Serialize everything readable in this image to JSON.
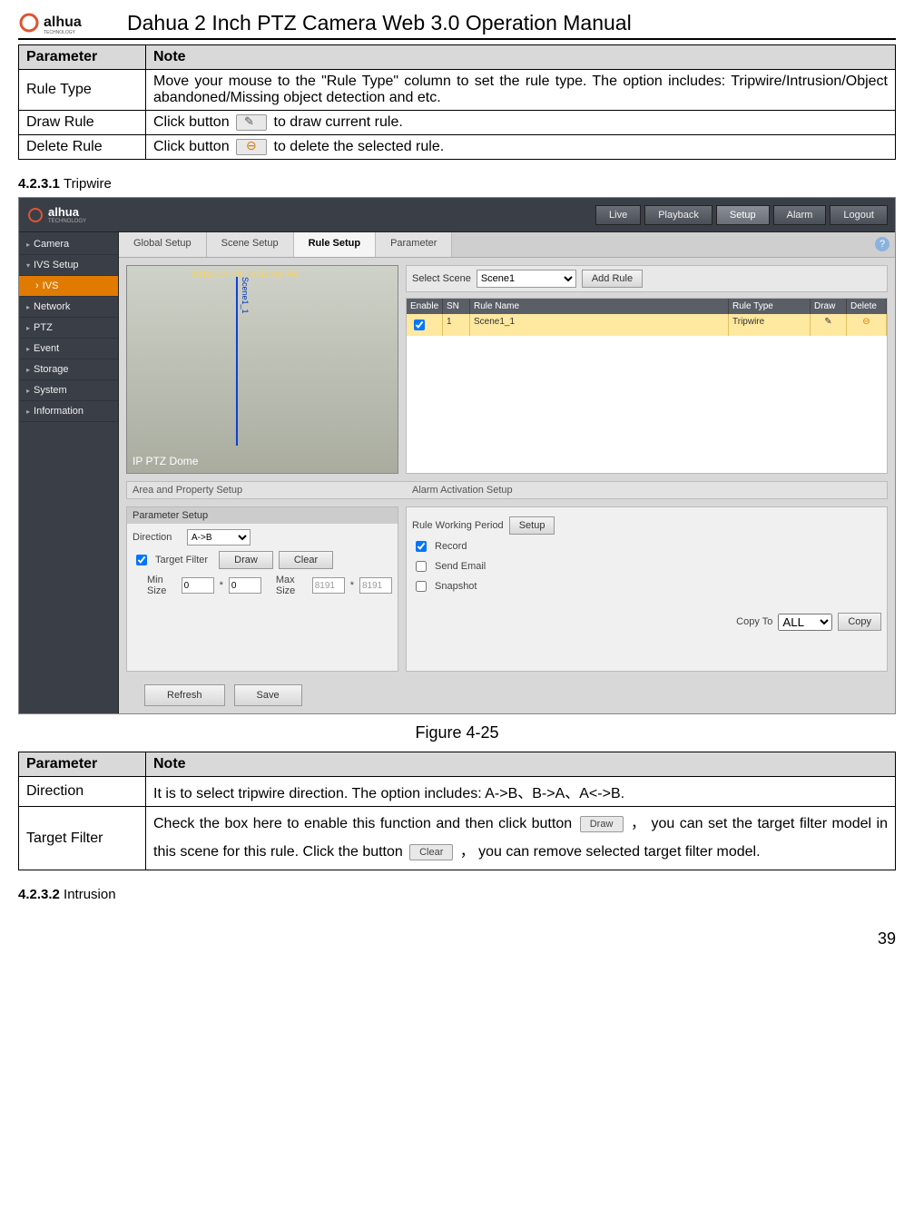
{
  "doc": {
    "title": "Dahua 2 Inch PTZ Camera Web 3.0 Operation Manual",
    "logo_text": "alhua",
    "logo_sub": "TECHNOLOGY",
    "page_number": "39"
  },
  "table1": {
    "header_param": "Parameter",
    "header_note": "Note",
    "row_rule_type_param": "Rule Type",
    "row_rule_type_note": "Move your mouse to the \"Rule Type\" column to set the rule type. The option includes: Tripwire/Intrusion/Object abandoned/Missing object detection and etc.",
    "row_draw_param": "Draw Rule",
    "row_draw_note_a": "Click button ",
    "row_draw_note_b": " to draw current rule.",
    "row_delete_param": "Delete Rule",
    "row_delete_note_a": "Click button ",
    "row_delete_note_b": " to delete the selected rule."
  },
  "section1": {
    "num": "4.2.3.1",
    "title": "Tripwire"
  },
  "figure1": {
    "caption": "Figure 4-25"
  },
  "ui": {
    "brand": "alhua",
    "brand_sub": "TECHNOLOGY",
    "top_tabs": [
      "Live",
      "Playback",
      "Setup",
      "Alarm",
      "Logout"
    ],
    "top_tab_active": "Setup",
    "sidebar": {
      "items": [
        {
          "label": "Camera",
          "level": 1
        },
        {
          "label": "IVS Setup",
          "level": 1
        },
        {
          "label": "IVS",
          "level": 2,
          "active": true
        },
        {
          "label": "Network",
          "level": 1
        },
        {
          "label": "PTZ",
          "level": 1
        },
        {
          "label": "Event",
          "level": 1
        },
        {
          "label": "Storage",
          "level": 1
        },
        {
          "label": "System",
          "level": 1
        },
        {
          "label": "Information",
          "level": 1
        }
      ]
    },
    "subtabs": [
      "Global Setup",
      "Scene Setup",
      "Rule Setup",
      "Parameter"
    ],
    "subtab_active": "Rule Setup",
    "preview": {
      "timestamp": "2013-12-19 14:51:04 Fri",
      "scene_label": "Scene1_1",
      "overlay": "IP PTZ Dome"
    },
    "scene": {
      "label": "Select Scene",
      "value": "Scene1",
      "add_rule": "Add Rule"
    },
    "rule_table": {
      "headers": [
        "Enable",
        "SN",
        "Rule Name",
        "Rule Type",
        "Draw",
        "Delete"
      ],
      "row": {
        "enable": true,
        "sn": "1",
        "name": "Scene1_1",
        "type": "Tripwire"
      }
    },
    "area_hdr_left": "Area and Property Setup",
    "area_hdr_right": "Alarm Activation Setup",
    "params": {
      "hdr": "Parameter Setup",
      "direction_label": "Direction",
      "direction_value": "A->B",
      "target_filter": "Target Filter",
      "draw": "Draw",
      "clear": "Clear",
      "min_size": "Min Size",
      "max_size": "Max Size",
      "min_a": "0",
      "min_b": "0",
      "max_a": "8191",
      "max_b": "8191",
      "star": "*"
    },
    "alarm": {
      "working": "Rule Working Period",
      "setup": "Setup",
      "record": "Record",
      "send_email": "Send Email",
      "snapshot": "Snapshot",
      "copy_to": "Copy To",
      "copy_to_value": "ALL",
      "copy": "Copy"
    },
    "bottom": {
      "refresh": "Refresh",
      "save": "Save"
    }
  },
  "table2": {
    "header_param": "Parameter",
    "header_note": "Note",
    "row_dir_param": "Direction",
    "row_dir_note": "It is to select tripwire direction. The option includes: A->B、B->A、A<->B.",
    "row_tf_param": "Target Filter",
    "row_tf_note_a": "Check the box here to enable this function and then click button ",
    "row_tf_note_b": "， you can set the target filter model in this scene for this rule. Click the button ",
    "row_tf_note_c": "， you can remove selected target filter model.",
    "btn_draw": "Draw",
    "btn_clear": "Clear"
  },
  "section2": {
    "num": "4.2.3.2",
    "title": "Intrusion"
  }
}
